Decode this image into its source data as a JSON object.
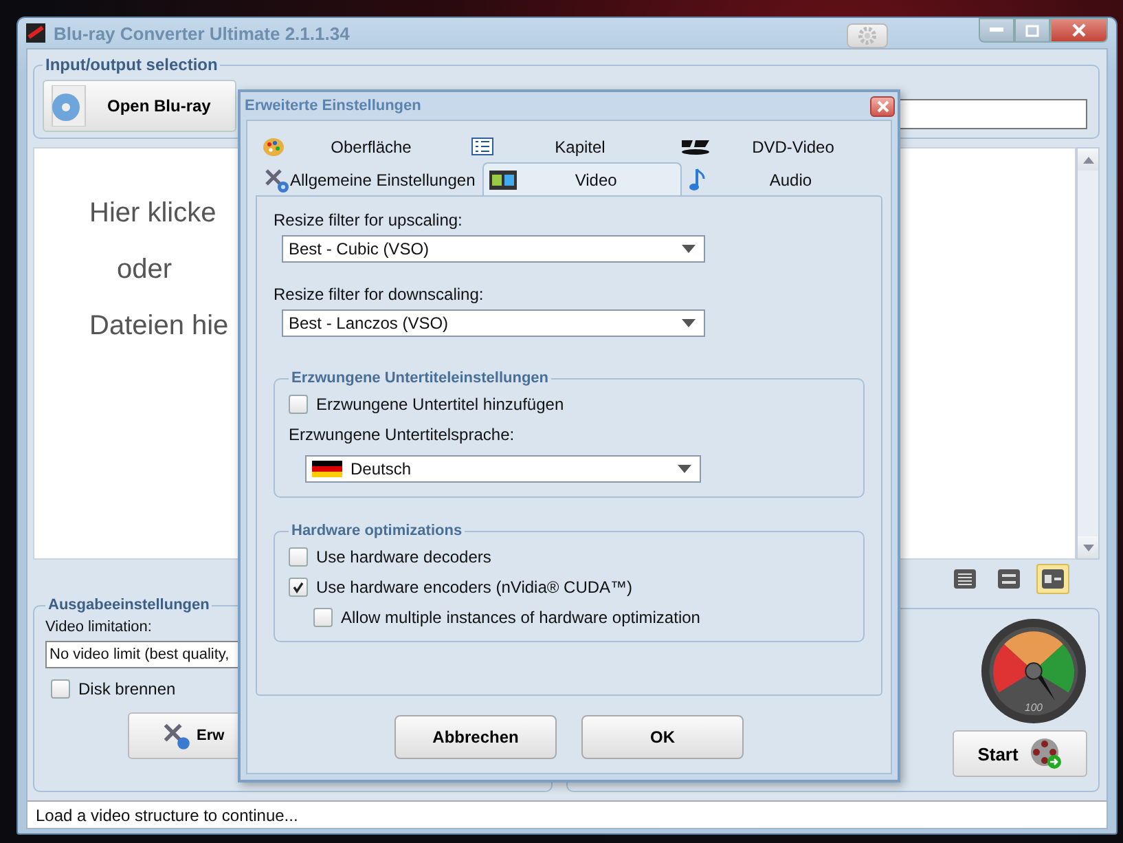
{
  "window": {
    "title": "Blu-ray Converter Ultimate 2.1.1.34"
  },
  "input_output": {
    "title": "Input/output selection",
    "open_button": "Open Blu-ray"
  },
  "drop_area": {
    "lines": [
      "Hier klicke",
      "oder",
      "Dateien hie"
    ]
  },
  "view_buttons": [
    {
      "selected": false
    },
    {
      "selected": false
    },
    {
      "selected": true
    }
  ],
  "output_settings": {
    "title": "Ausgabeeinstellungen",
    "video_limitation_label": "Video limitation:",
    "video_limitation_value": "No video limit (best quality,",
    "burn_disc": {
      "label": "Disk brennen",
      "checked": false
    },
    "advanced_button": "Erw"
  },
  "gauge": {
    "label": "100"
  },
  "start_button": "Start",
  "status_bar": "Load a video structure to continue...",
  "dialog": {
    "title": "Erweiterte Einstellungen",
    "tab_rows": [
      [
        {
          "label": "Oberfläche",
          "selected": false
        },
        {
          "label": "Kapitel",
          "selected": false
        },
        {
          "label": "DVD-Video",
          "selected": false
        }
      ],
      [
        {
          "label": "Allgemeine Einstellungen",
          "selected": false
        },
        {
          "label": "Video",
          "selected": true
        },
        {
          "label": "Audio",
          "selected": false
        }
      ]
    ],
    "upscaling": {
      "label": "Resize filter for upscaling:",
      "value": "Best - Cubic (VSO)"
    },
    "downscaling": {
      "label": "Resize filter for downscaling:",
      "value": "Best - Lanczos (VSO)"
    },
    "subtitles": {
      "title": "Erzwungene Untertiteleinstellungen",
      "add": {
        "label": "Erzwungene Untertitel hinzufügen",
        "checked": false
      },
      "language_label": "Erzwungene Untertitelsprache:",
      "language": "Deutsch"
    },
    "hardware": {
      "title": "Hardware optimizations",
      "options": [
        {
          "label": "Use hardware decoders",
          "checked": false
        },
        {
          "label": "Use hardware encoders (nVidia® CUDA™)",
          "checked": true,
          "children": [
            {
              "label": "Allow multiple instances of hardware optimization",
              "checked": false
            }
          ]
        }
      ]
    },
    "buttons": [
      "Abbrechen",
      "OK"
    ]
  }
}
